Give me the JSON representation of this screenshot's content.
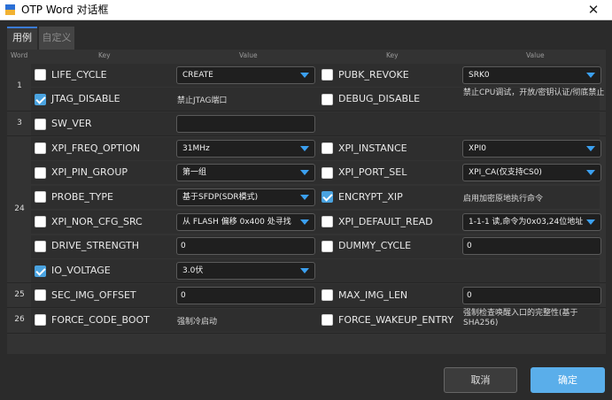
{
  "window": {
    "title": "OTP Word 对话框",
    "close_glyph": "✕",
    "icon": "app-logo-icon",
    "close_icon": "close-icon"
  },
  "tabs": [
    {
      "label": "用例",
      "active": true
    },
    {
      "label": "自定义",
      "active": false
    }
  ],
  "headers": {
    "word": "Word",
    "key_left": "Key",
    "value_left": "Value",
    "key_right": "Key",
    "value_right": "Value"
  },
  "words": {
    "w1": "1",
    "w3": "3",
    "w24": "24",
    "w25": "25",
    "w26": "26"
  },
  "rows": {
    "r1": {
      "left": {
        "key": "LIFE_CYCLE",
        "checked": false,
        "value": "CREATE"
      },
      "right": {
        "key": "PUBK_REVOKE",
        "checked": false,
        "value": "SRK0"
      }
    },
    "r2": {
      "left": {
        "key": "JTAG_DISABLE",
        "checked": true,
        "value": "禁止JTAG端口"
      },
      "right": {
        "key": "DEBUG_DISABLE",
        "checked": false,
        "value": "禁止CPU调试，开放/密钥认证/彻底禁止"
      }
    },
    "r3": {
      "left": {
        "key": "SW_VER",
        "checked": false,
        "value": ""
      }
    },
    "r4": {
      "left": {
        "key": "XPI_FREQ_OPTION",
        "checked": false,
        "value": "31MHz"
      },
      "right": {
        "key": "XPI_INSTANCE",
        "checked": false,
        "value": "XPI0"
      }
    },
    "r5": {
      "left": {
        "key": "XPI_PIN_GROUP",
        "checked": false,
        "value": "第一组"
      },
      "right": {
        "key": "XPI_PORT_SEL",
        "checked": false,
        "value": "XPI_CA(仅支持CS0)"
      }
    },
    "r6": {
      "left": {
        "key": "PROBE_TYPE",
        "checked": false,
        "value": "基于SFDP(SDR模式)"
      },
      "right": {
        "key": "ENCRYPT_XIP",
        "checked": true,
        "value": "启用加密原地执行命令"
      }
    },
    "r7": {
      "left": {
        "key": "XPI_NOR_CFG_SRC",
        "checked": false,
        "value": "从 FLASH 偏移 0x400 处寻找"
      },
      "right": {
        "key": "XPI_DEFAULT_READ",
        "checked": false,
        "value": "1-1-1 读,命令为0x03,24位地址"
      }
    },
    "r8": {
      "left": {
        "key": "DRIVE_STRENGTH",
        "checked": false,
        "value": "0"
      },
      "right": {
        "key": "DUMMY_CYCLE",
        "checked": false,
        "value": "0"
      }
    },
    "r9": {
      "left": {
        "key": "IO_VOLTAGE",
        "checked": true,
        "value": "3.0伏"
      }
    },
    "r10": {
      "left": {
        "key": "SEC_IMG_OFFSET",
        "checked": false,
        "value": "0"
      },
      "right": {
        "key": "MAX_IMG_LEN",
        "checked": false,
        "value": "0"
      }
    },
    "r11": {
      "left": {
        "key": "FORCE_CODE_BOOT",
        "checked": false,
        "value": "强制冷启动"
      },
      "right": {
        "key": "FORCE_WAKEUP_ENTRY",
        "checked": false,
        "value": "强制检查唤醒入口的完整性(基于SHA256)"
      }
    }
  },
  "buttons": {
    "cancel": "取消",
    "ok": "确定"
  },
  "colors": {
    "accent": "#5aaeea",
    "dropdown_arrow": "#3ba0f0",
    "checkbox_on": "#4aa3e0"
  }
}
